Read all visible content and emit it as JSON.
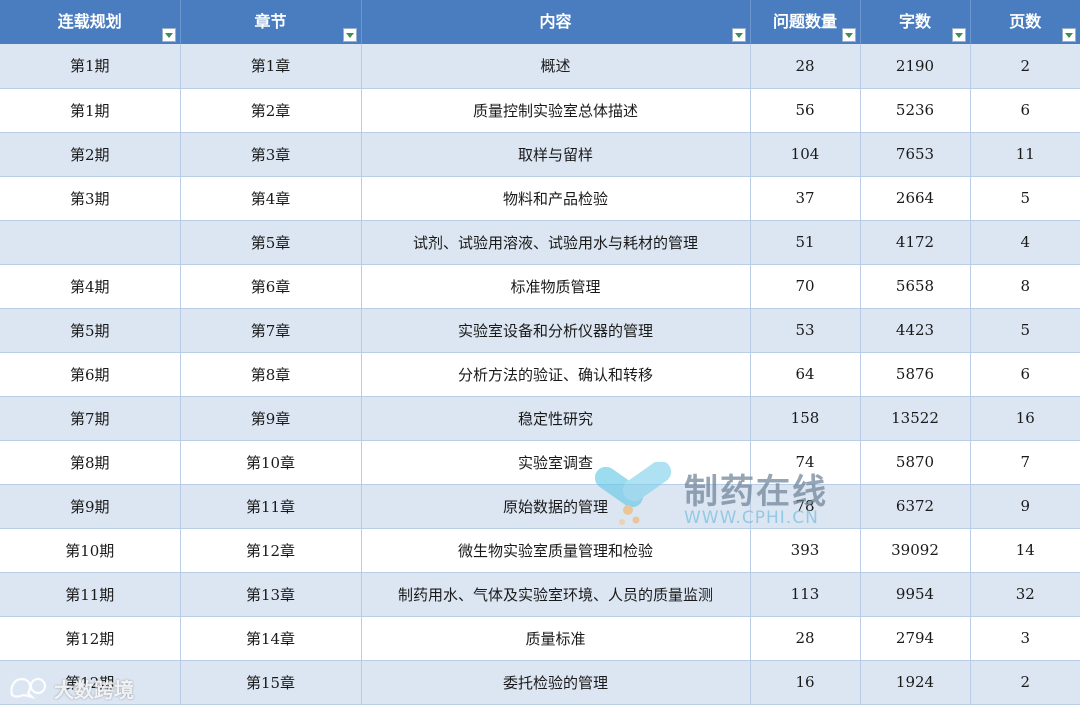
{
  "table": {
    "headers": [
      "连载规划",
      "章节",
      "内容",
      "问题数量",
      "字数",
      "页数"
    ],
    "rows": [
      [
        "第1期",
        "第1章",
        "概述",
        "28",
        "2190",
        "2"
      ],
      [
        "第1期",
        "第2章",
        "质量控制实验室总体描述",
        "56",
        "5236",
        "6"
      ],
      [
        "第2期",
        "第3章",
        "取样与留样",
        "104",
        "7653",
        "11"
      ],
      [
        "第3期",
        "第4章",
        "物料和产品检验",
        "37",
        "2664",
        "5"
      ],
      [
        "",
        "第5章",
        "试剂、试验用溶液、试验用水与耗材的管理",
        "51",
        "4172",
        "4"
      ],
      [
        "第4期",
        "第6章",
        "标准物质管理",
        "70",
        "5658",
        "8"
      ],
      [
        "第5期",
        "第7章",
        "实验室设备和分析仪器的管理",
        "53",
        "4423",
        "5"
      ],
      [
        "第6期",
        "第8章",
        "分析方法的验证、确认和转移",
        "64",
        "5876",
        "6"
      ],
      [
        "第7期",
        "第9章",
        "稳定性研究",
        "158",
        "13522",
        "16"
      ],
      [
        "第8期",
        "第10章",
        "实验室调查",
        "74",
        "5870",
        "7"
      ],
      [
        "第9期",
        "第11章",
        "原始数据的管理",
        "78",
        "6372",
        "9"
      ],
      [
        "第10期",
        "第12章",
        "微生物实验室质量管理和检验",
        "393",
        "39092",
        "14"
      ],
      [
        "第11期",
        "第13章",
        "制药用水、气体及实验室环境、人员的质量监测",
        "113",
        "9954",
        "32"
      ],
      [
        "第12期",
        "第14章",
        "质量标准",
        "28",
        "2794",
        "3"
      ],
      [
        "第12期",
        "第15章",
        "委托检验的管理",
        "16",
        "1924",
        "2"
      ]
    ]
  },
  "watermark": {
    "title": "制药在线",
    "url": "WWW.CPHI.CN",
    "corner_text": "大数跨境"
  },
  "colors": {
    "header_bg": "#4a7cc0",
    "band_row": "#dce6f2",
    "filter_arrow": "#3e8f5a"
  }
}
